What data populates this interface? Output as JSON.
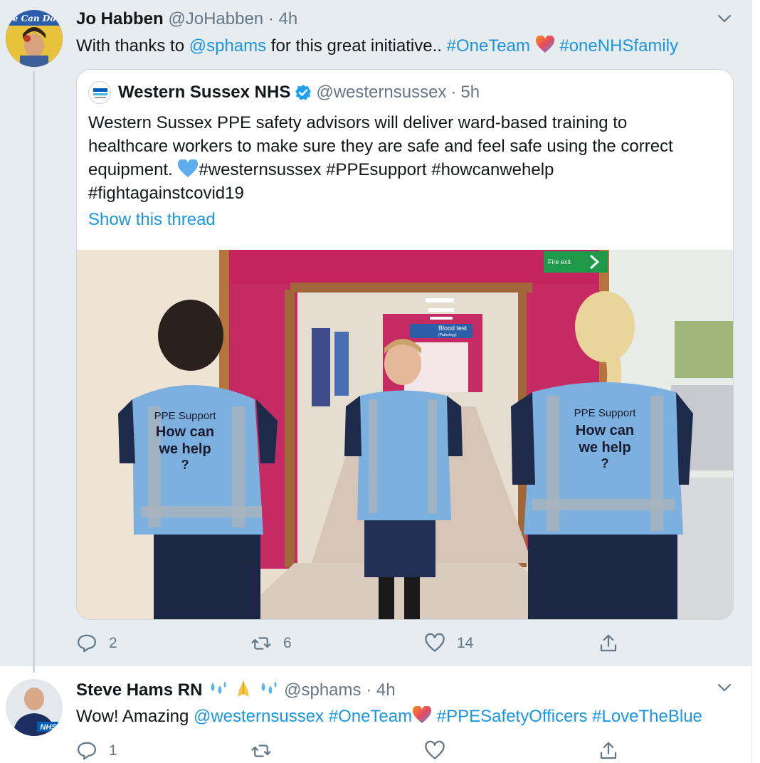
{
  "tweet1": {
    "name": "Jo Habben",
    "handle": "@JoHabben",
    "separator": "·",
    "time": "4h",
    "avatar_text": "e Can Do",
    "text": {
      "prefix": "With thanks to ",
      "mention": "@sphams",
      "middle": " for this great initiative.. ",
      "hashtag1": "#OneTeam",
      "hashtag2": "#oneNHSfamily"
    },
    "actions": {
      "reply_count": "2",
      "retweet_count": "6",
      "like_count": "14"
    }
  },
  "quoted": {
    "name": "Western Sussex NHS",
    "handle": "@westernsussex",
    "separator": "·",
    "time": "5h",
    "lines": [
      "Western Sussex PPE safety advisors will deliver ward-based training to",
      "healthcare workers to make sure they are safe and feel safe using the correct",
      "equipment. ",
      "#westernsussex #PPEsupport #howcanwehelp",
      "#fightagainstcovid19"
    ],
    "show_thread": "Show this thread",
    "photo": {
      "sign_blood": "Blood test",
      "sign_blood_sub": "(Pathology)",
      "sign_fire": "Fire exit",
      "vest_left": [
        "PPE Support",
        "How can",
        "we help",
        "?"
      ],
      "vest_right": [
        "PPE Support",
        "How can",
        "we help",
        "?"
      ]
    }
  },
  "tweet2": {
    "name": "Steve Hams RN",
    "handle": "@sphams",
    "separator": "·",
    "time": "4h",
    "avatar_text": "NHS",
    "text": {
      "prefix": "Wow! Amazing ",
      "mention": "@westernsussex",
      "hashtag1": " #OneTeam",
      "hashtag2": "#PPESafetyOfficers",
      "hashtag3": "#LoveTheBlue"
    },
    "actions": {
      "reply_count": "1"
    }
  },
  "colors": {
    "link": "#1b95e0",
    "muted": "#657786",
    "thread_bg": "#e6ecf0",
    "verified": "#1da1f2"
  }
}
